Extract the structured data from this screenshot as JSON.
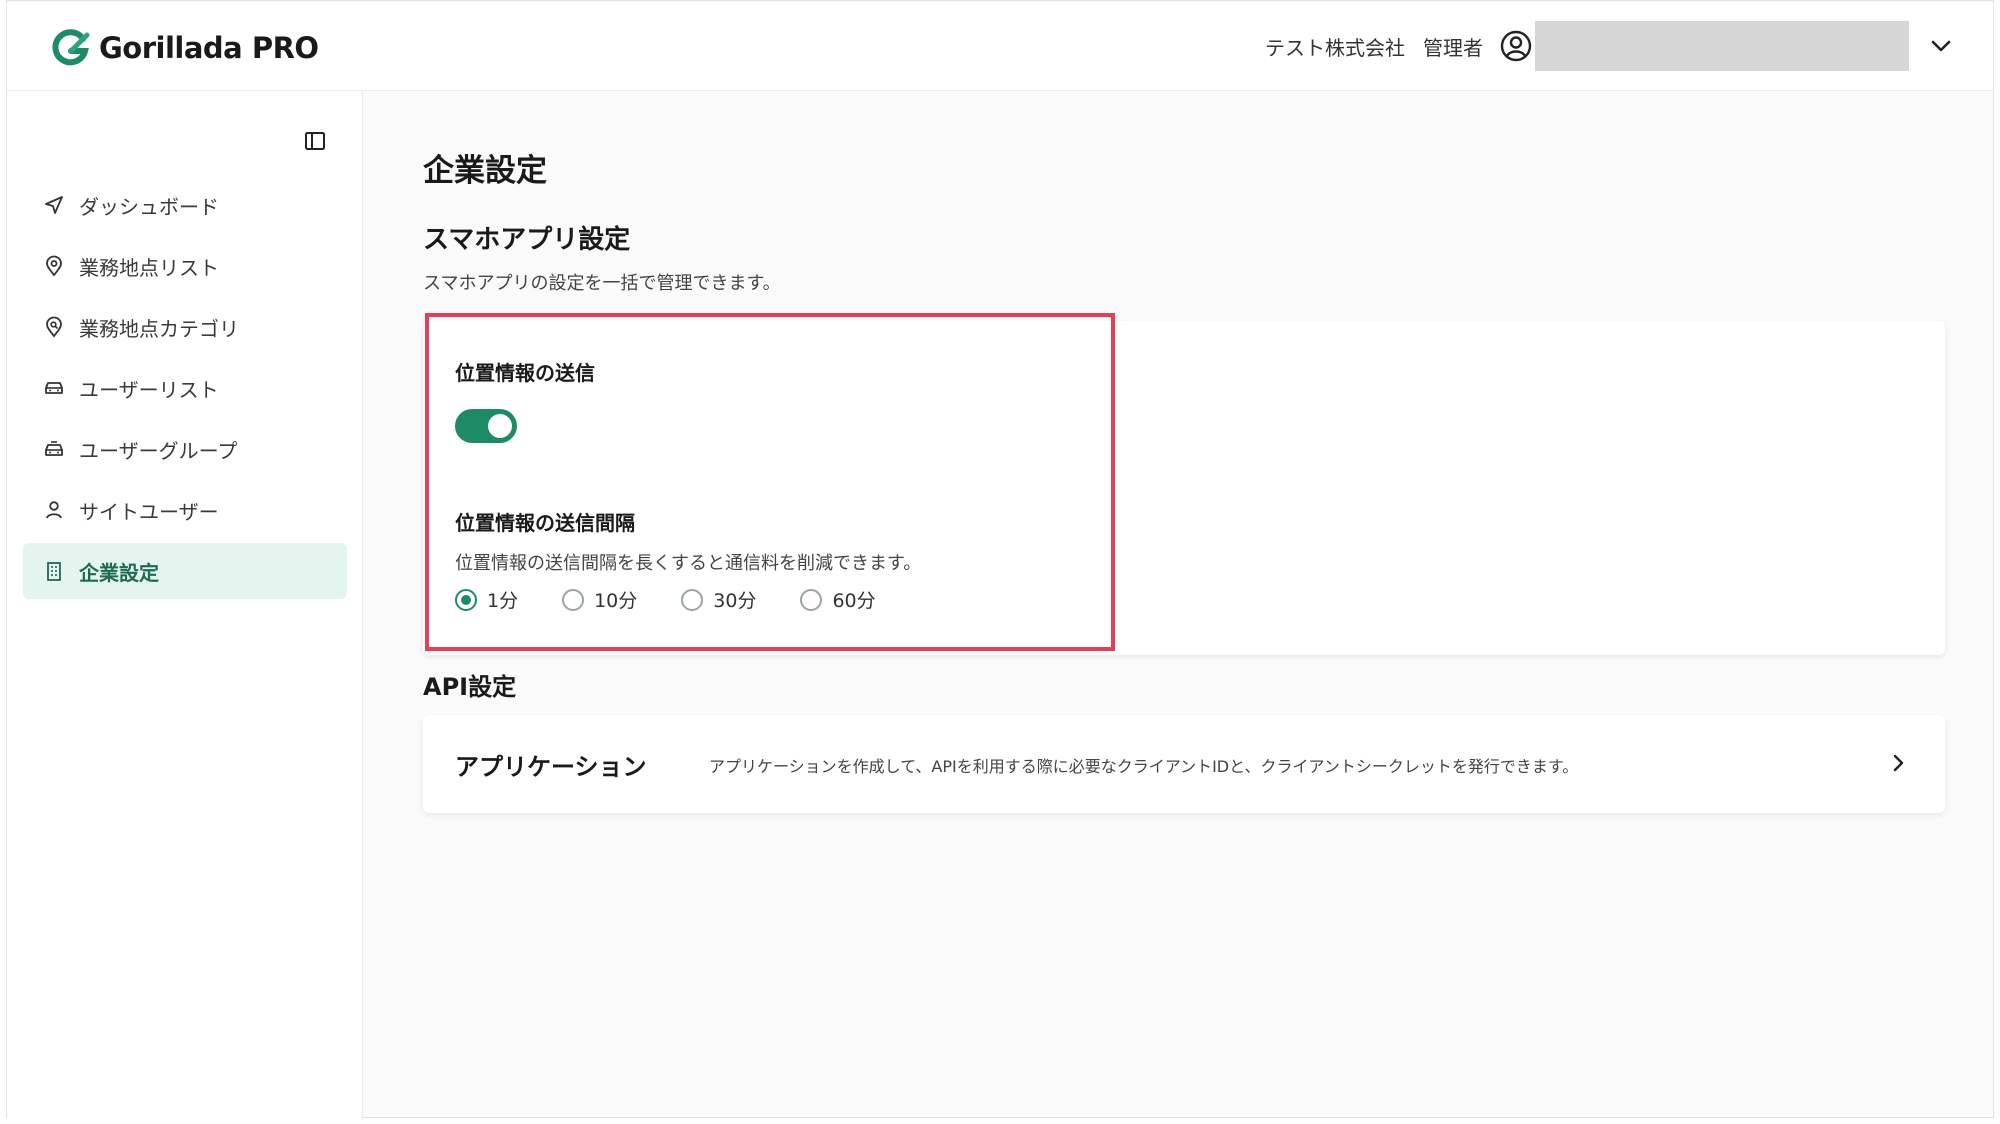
{
  "header": {
    "logo_text": "Gorillada PRO",
    "company": "テスト株式会社",
    "role": "管理者"
  },
  "sidebar": {
    "items": [
      {
        "label": "ダッシュボード",
        "icon": "navigation-arrow-icon"
      },
      {
        "label": "業務地点リスト",
        "icon": "map-pin-icon"
      },
      {
        "label": "業務地点カテゴリ",
        "icon": "map-pin-search-icon"
      },
      {
        "label": "ユーザーリスト",
        "icon": "car-icon"
      },
      {
        "label": "ユーザーグループ",
        "icon": "car-group-icon"
      },
      {
        "label": "サイトユーザー",
        "icon": "person-icon"
      },
      {
        "label": "企業設定",
        "icon": "building-icon",
        "active": true
      }
    ]
  },
  "main": {
    "page_title": "企業設定",
    "app_section": {
      "title": "スマホアプリ設定",
      "description": "スマホアプリの設定を一括で管理できます。",
      "send_location_label": "位置情報の送信",
      "send_location_enabled": true,
      "interval_label": "位置情報の送信間隔",
      "interval_description": "位置情報の送信間隔を長くすると通信料を削減できます。",
      "interval_options": [
        "1分",
        "10分",
        "30分",
        "60分"
      ],
      "interval_selected": "1分"
    },
    "api_section": {
      "title": "API設定",
      "app_name": "アプリケーション",
      "app_description": "アプリケーションを作成して、APIを利用する際に必要なクライアントIDと、クライアントシークレットを発行できます。"
    }
  },
  "colors": {
    "accent": "#1f8a66",
    "active_bg": "#e4f5ef",
    "highlight_border": "#e0405a"
  }
}
